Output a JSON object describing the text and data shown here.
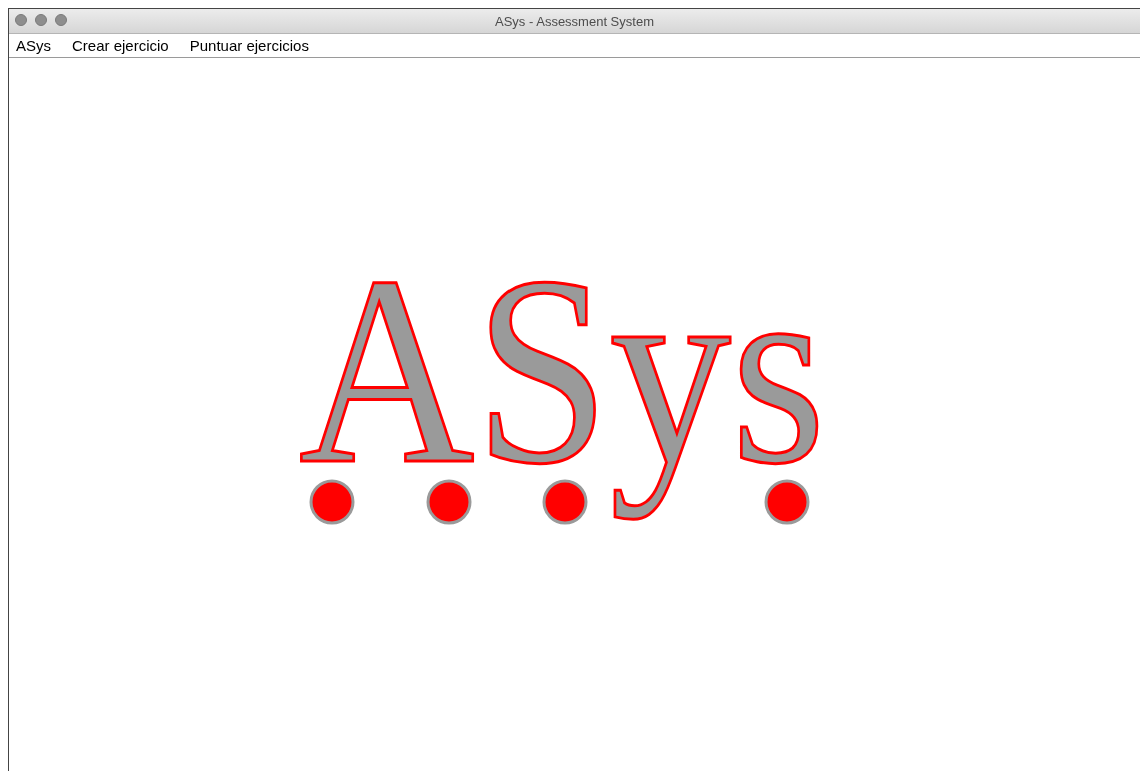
{
  "window": {
    "title": "ASys - Assessment System"
  },
  "menu": [
    {
      "label": "ASys"
    },
    {
      "label": "Crear ejercicio"
    },
    {
      "label": "Puntuar ejercicios"
    }
  ],
  "logo": {
    "text": "ASys"
  }
}
